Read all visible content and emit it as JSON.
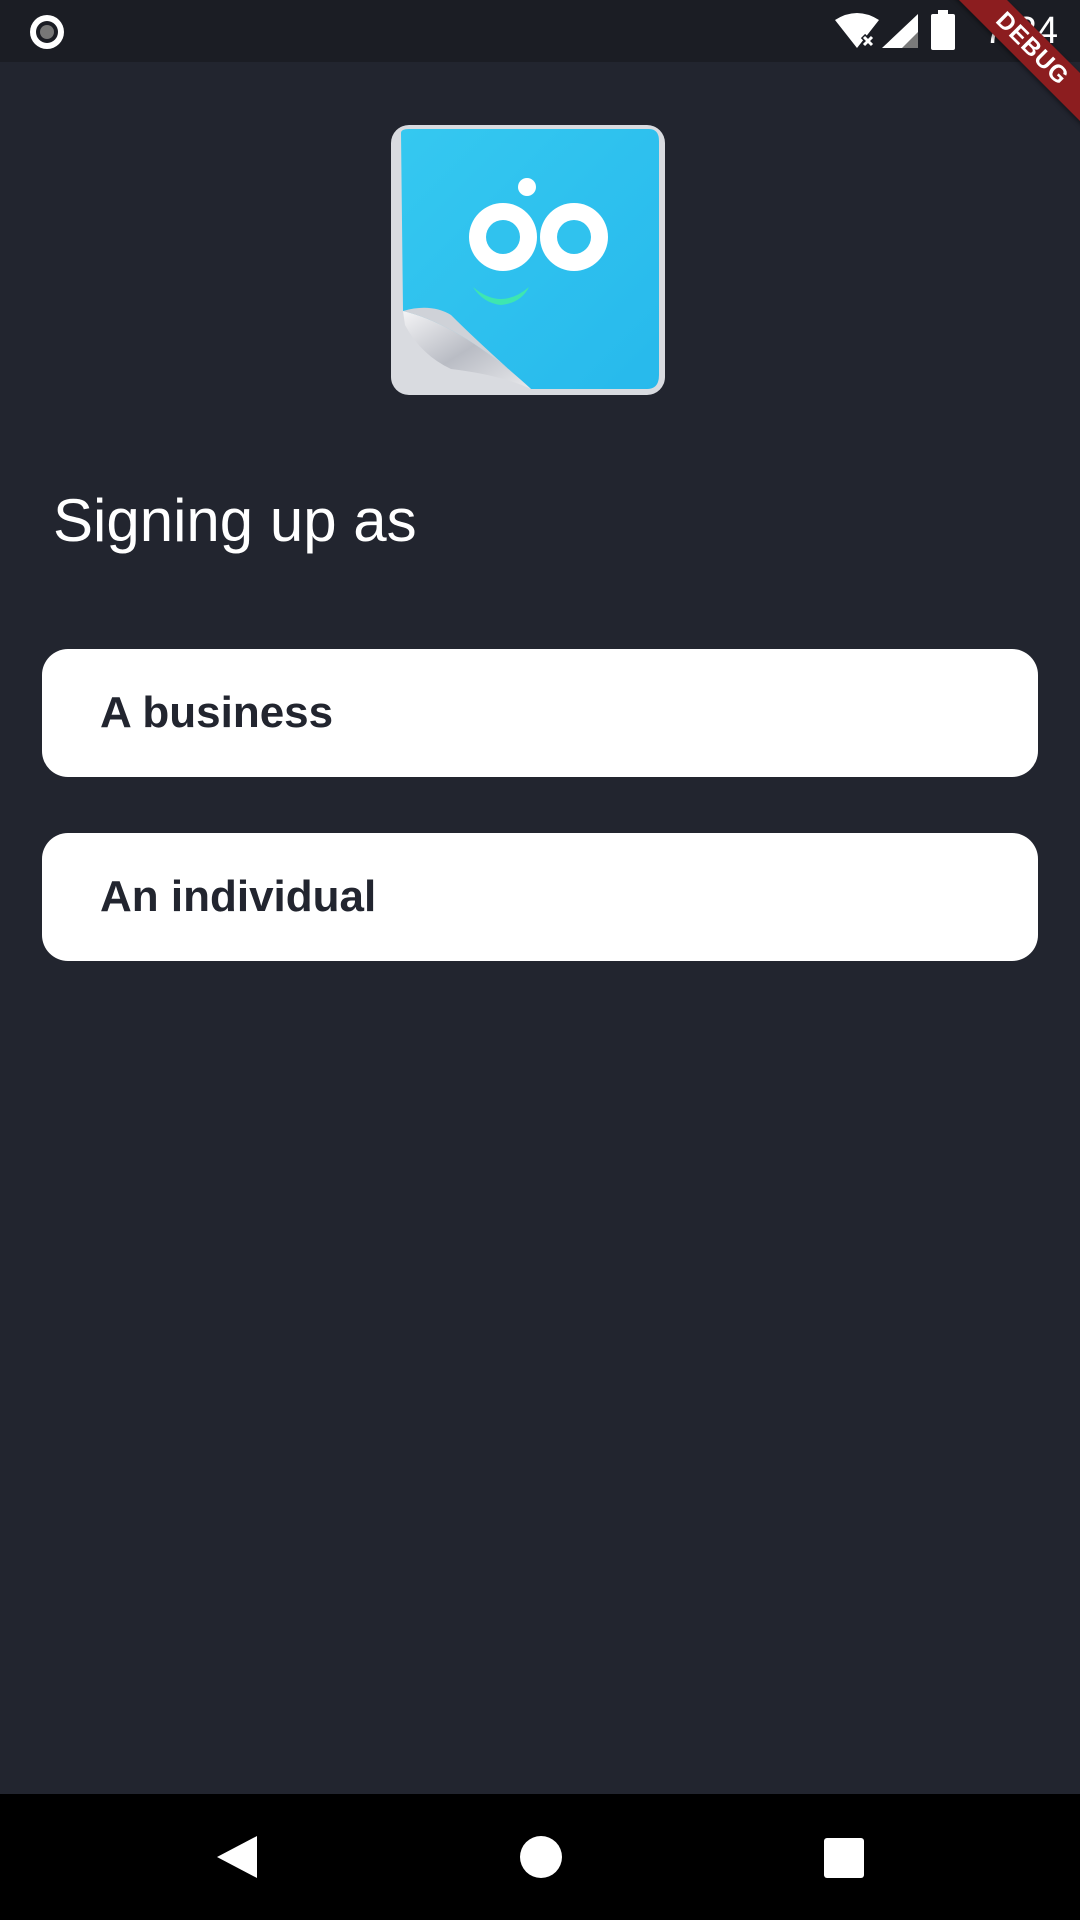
{
  "status_bar": {
    "time": "7:34",
    "debug_label": "DEBUG",
    "icons": [
      "record-icon",
      "wifi-off-icon",
      "cell-signal-icon",
      "battery-icon"
    ]
  },
  "logo": {
    "name": "app-logo",
    "colors": {
      "tile": "#2ec4ef",
      "smile": "#3ee6b0",
      "letters": "#ffffff"
    }
  },
  "main": {
    "title": "Signing up as",
    "options": [
      {
        "label": "A business"
      },
      {
        "label": "An individual"
      }
    ]
  },
  "nav_bar": {
    "icons": [
      "back-icon",
      "home-icon",
      "recents-icon"
    ]
  },
  "colors": {
    "background": "#22252f",
    "button_bg": "#ffffff",
    "button_text": "#22252f",
    "debug_ribbon": "#8c1d1f"
  }
}
